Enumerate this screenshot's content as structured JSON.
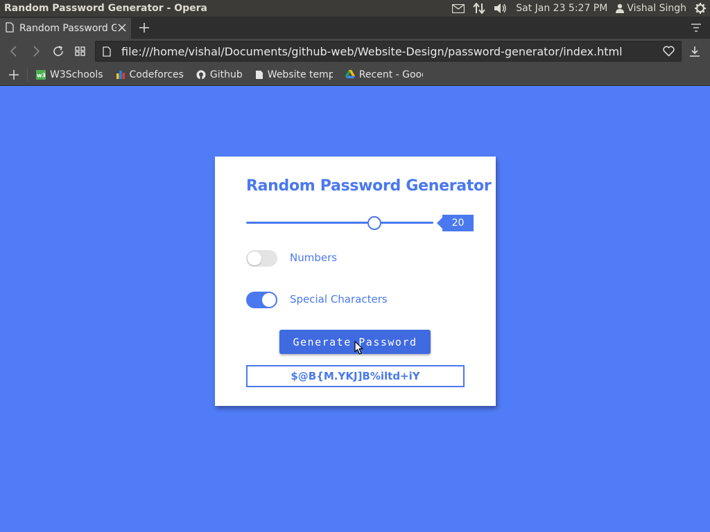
{
  "os": {
    "window_title": "Random Password Generator - Opera",
    "datetime": "Sat Jan 23  5:27 PM",
    "user": "Vishal Singh"
  },
  "browser": {
    "tab_label": "Random Password G",
    "url": "file:///home/vishal/Documents/github-web/Website-Design/password-generator/index.html",
    "bookmarks": [
      {
        "label": "W3Schools",
        "icon": "w3schools-icon"
      },
      {
        "label": "Codeforces",
        "icon": "codeforces-icon"
      },
      {
        "label": "Github",
        "icon": "github-icon"
      },
      {
        "label": "Website templat",
        "icon": "page-icon"
      },
      {
        "label": "Recent - Google",
        "icon": "google-drive-icon"
      }
    ]
  },
  "app": {
    "title": "Random Password Generator",
    "slider": {
      "value": "20",
      "position_fraction": 0.685
    },
    "options": [
      {
        "label": "Numbers",
        "enabled": false
      },
      {
        "label": "Special Characters",
        "enabled": true
      }
    ],
    "generate_label": "Generate Password",
    "password": "$@B{M.YKJ]B%iltd+iY"
  },
  "colors": {
    "page_background": "#517cf7",
    "accent": "#4a78ee",
    "button": "#3f6ae0"
  }
}
